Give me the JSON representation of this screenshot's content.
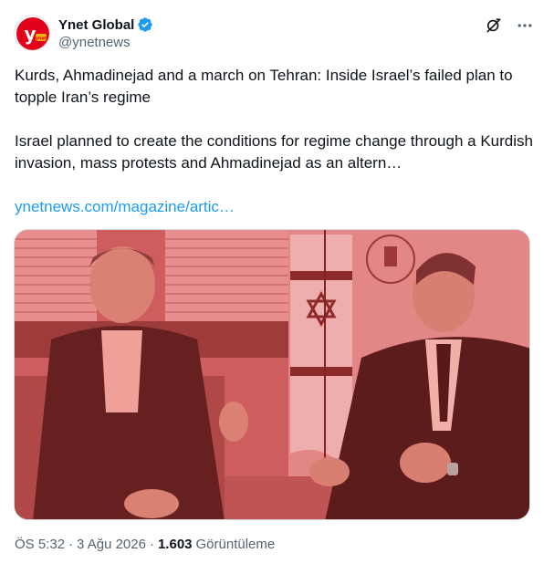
{
  "author": {
    "display_name": "Ynet Global",
    "handle": "@ynetnews",
    "avatar_icon": "ynet-logo-icon",
    "avatar_text": "ynet",
    "verified_color": "#1d9bf0"
  },
  "actions": {
    "grok_icon": "grok-icon",
    "more_icon": "more-icon"
  },
  "post": {
    "headline": "Kurds, Ahmadinejad and a march on Tehran: Inside Israel’s failed plan to topple Iran’s regime",
    "summary": "Israel planned to create the conditions for regime change through a Kurdish invasion, mass protests and Ahmadinejad as an altern…",
    "link_text": "ynetnews.com/magazine/artic…",
    "link_color": "#1d9bf0"
  },
  "media": {
    "description_icon": "photo-image",
    "tint_color": "#e85a5a"
  },
  "meta": {
    "time": "ÖS 5:32",
    "separator": "·",
    "date": "3 Ağu 2026",
    "views_count": "1.603",
    "views_label": "Görüntüleme"
  }
}
